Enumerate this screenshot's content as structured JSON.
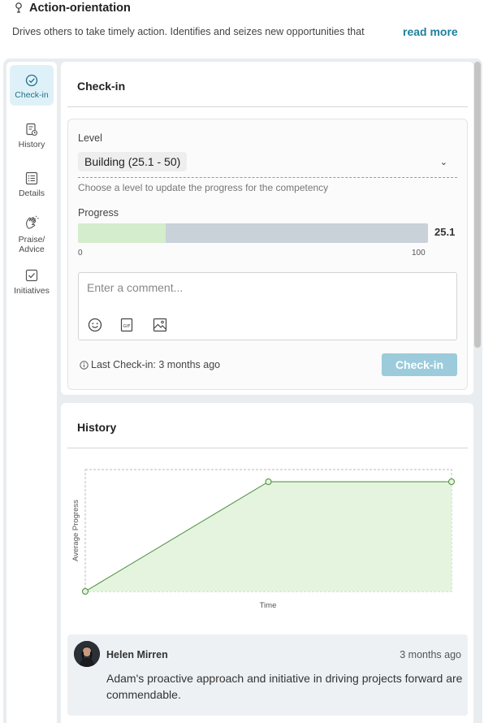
{
  "competency": {
    "title": "Action-orientation",
    "description": "Drives others to take timely action. Identifies and seizes new opportunities that",
    "read_more": "read more"
  },
  "sidebar": {
    "items": [
      {
        "label": "Check-in",
        "icon": "check-circle-icon",
        "active": true
      },
      {
        "label": "History",
        "icon": "history-doc-icon",
        "active": false
      },
      {
        "label": "Details",
        "icon": "list-icon",
        "active": false
      },
      {
        "label": "Praise/ Advice",
        "icon": "clapping-hands-icon",
        "active": false
      },
      {
        "label": "Initiatives",
        "icon": "checkbox-icon",
        "active": false
      }
    ]
  },
  "checkin": {
    "title": "Check-in",
    "level_label": "Level",
    "level_value": "Building (25.1 - 50)",
    "level_hint": "Choose a level to update the progress for the competency",
    "progress_label": "Progress",
    "progress_value": 25.1,
    "progress_value_text": "25.1",
    "progress_min": "0",
    "progress_max": "100",
    "comment_placeholder": "Enter a comment...",
    "last_checkin": "Last Check-in: 3 months ago",
    "button_label": "Check-in"
  },
  "history": {
    "title": "History",
    "entry": {
      "name": "Helen Mirren",
      "time": "3 months ago",
      "text": "Adam's proactive approach and initiative in driving projects forward are commendable."
    }
  },
  "chart_data": {
    "type": "area",
    "x": [
      0,
      1,
      2
    ],
    "values": [
      0,
      90,
      90
    ],
    "ylim": [
      0,
      100
    ],
    "xlabel": "Time",
    "ylabel": "Average Progress",
    "grid": false
  },
  "colors": {
    "accent": "#1e7f9c",
    "button": "#9ccbdc",
    "progress_fill": "#d4edcc",
    "progress_track": "#c9d1d9",
    "chart_line": "#4a8a3a",
    "chart_fill": "#e4f4de"
  }
}
